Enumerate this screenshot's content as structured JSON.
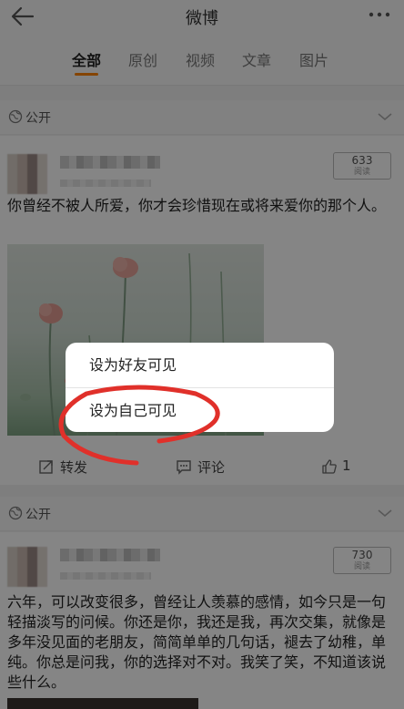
{
  "header": {
    "title": "微博"
  },
  "tabs": [
    {
      "label": "全部"
    },
    {
      "label": "原创"
    },
    {
      "label": "视频"
    },
    {
      "label": "文章"
    },
    {
      "label": "图片"
    }
  ],
  "posts": [
    {
      "visibility": "公开",
      "views": {
        "count": "633",
        "unit": "阅读"
      },
      "text": "你曾经不被人所爱，你才会珍惜现在或将来爱你的那个人。",
      "actions": {
        "repost": "转发",
        "comment": "评论",
        "like_count": "1"
      }
    },
    {
      "visibility": "公开",
      "views": {
        "count": "730",
        "unit": "阅读"
      },
      "text": "六年，可以改变很多，曾经让人羡慕的感情，如今只是一句轻描淡写的问候。你还是你，我还是我，再次交集，就像是多年没见面的老朋友，简简单单的几句话，褪去了幼稚，单纯。你总是问我，你的选择对不对。我笑了笑，不知道该说些什么。"
    }
  ],
  "popup": {
    "option_friends": "设为好友可见",
    "option_self": "设为自己可见"
  },
  "colors": {
    "accent": "#ff8200",
    "annotation": "#e0302a"
  }
}
